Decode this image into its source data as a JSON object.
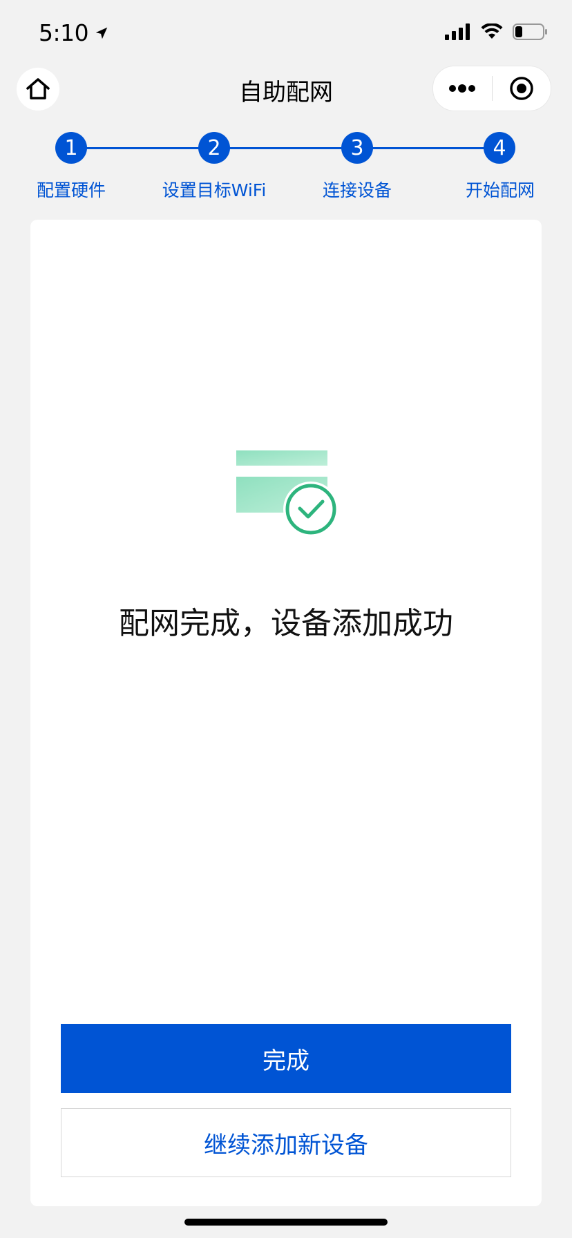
{
  "status_bar": {
    "time": "5:10"
  },
  "nav": {
    "title": "自助配网",
    "icons": {
      "home": "home-icon",
      "more": "more-dots-icon",
      "close": "target-circle-icon"
    }
  },
  "stepper": {
    "steps": [
      {
        "number": "1",
        "label": "配置硬件"
      },
      {
        "number": "2",
        "label": "设置目标WiFi"
      },
      {
        "number": "3",
        "label": "连接设备"
      },
      {
        "number": "4",
        "label": "开始配网"
      }
    ],
    "accent_color": "#0054d4"
  },
  "main": {
    "illustration_icon": "card-check-icon",
    "message": "配网完成，设备添加成功",
    "primary_button": "完成",
    "secondary_button": "继续添加新设备"
  },
  "colors": {
    "accent": "#0054d4",
    "success": "#2db47d",
    "background": "#f2f2f2"
  }
}
